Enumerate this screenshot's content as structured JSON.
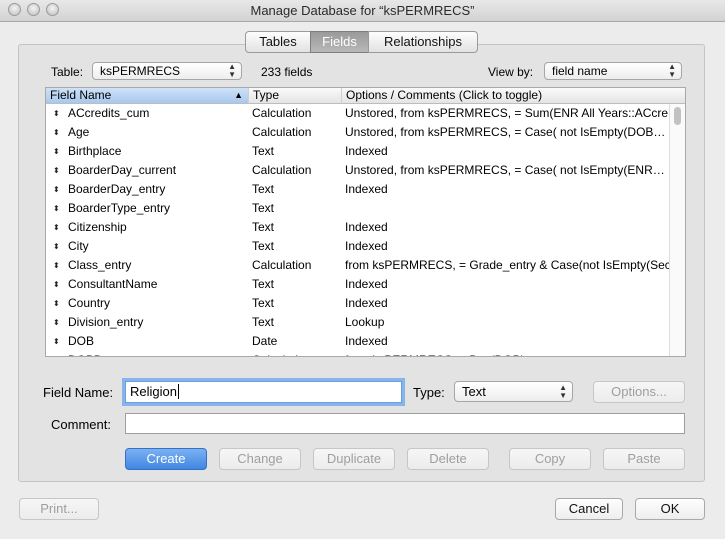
{
  "window": {
    "title": "Manage Database for “ksPERMRECS”"
  },
  "tabs": [
    {
      "label": "Tables",
      "active": false
    },
    {
      "label": "Fields",
      "active": true
    },
    {
      "label": "Relationships",
      "active": false
    }
  ],
  "toolbar": {
    "table_label": "Table:",
    "table_value": "ksPERMRECS",
    "field_count": "233 fields",
    "view_by_label": "View by:",
    "view_by_value": "field name"
  },
  "fields_table": {
    "columns": [
      "Field Name",
      "Type",
      "Options / Comments   (Click to toggle)"
    ],
    "rows": [
      [
        "ACcredits_cum",
        "Calculation",
        "Unstored, from ksPERMRECS, = Sum(ENR All Years::ACcre…"
      ],
      [
        "Age",
        "Calculation",
        "Unstored, from ksPERMRECS, = Case(      not IsEmpty(DOB…"
      ],
      [
        "Birthplace",
        "Text",
        "Indexed"
      ],
      [
        "BoarderDay_current",
        "Calculation",
        "Unstored, from ksPERMRECS, = Case(      not IsEmpty(ENR…"
      ],
      [
        "BoarderDay_entry",
        "Text",
        "Indexed"
      ],
      [
        "BoarderType_entry",
        "Text",
        ""
      ],
      [
        "Citizenship",
        "Text",
        "Indexed"
      ],
      [
        "City",
        "Text",
        "Indexed"
      ],
      [
        "Class_entry",
        "Calculation",
        "from ksPERMRECS, = Grade_entry & Case(not IsEmpty(Sec…"
      ],
      [
        "ConsultantName",
        "Text",
        "Indexed"
      ],
      [
        "Country",
        "Text",
        "Indexed"
      ],
      [
        "Division_entry",
        "Text",
        "Lookup"
      ],
      [
        "DOB",
        "Date",
        "Indexed"
      ],
      [
        "DOBD",
        "Calculation",
        "from ksPERMRECS, = Day(DOB)"
      ]
    ]
  },
  "form": {
    "field_name_label": "Field Name:",
    "field_name_value": "Religion",
    "type_label": "Type:",
    "type_value": "Text",
    "options_button": "Options...",
    "comment_label": "Comment:",
    "comment_value": ""
  },
  "actions": {
    "create": "Create",
    "change": "Change",
    "duplicate": "Duplicate",
    "delete": "Delete",
    "copy": "Copy",
    "paste": "Paste"
  },
  "footer": {
    "print": "Print...",
    "cancel": "Cancel",
    "ok": "OK"
  },
  "colors": {
    "accent": "#3f86e2",
    "selection_header": "#a8c8ee"
  }
}
